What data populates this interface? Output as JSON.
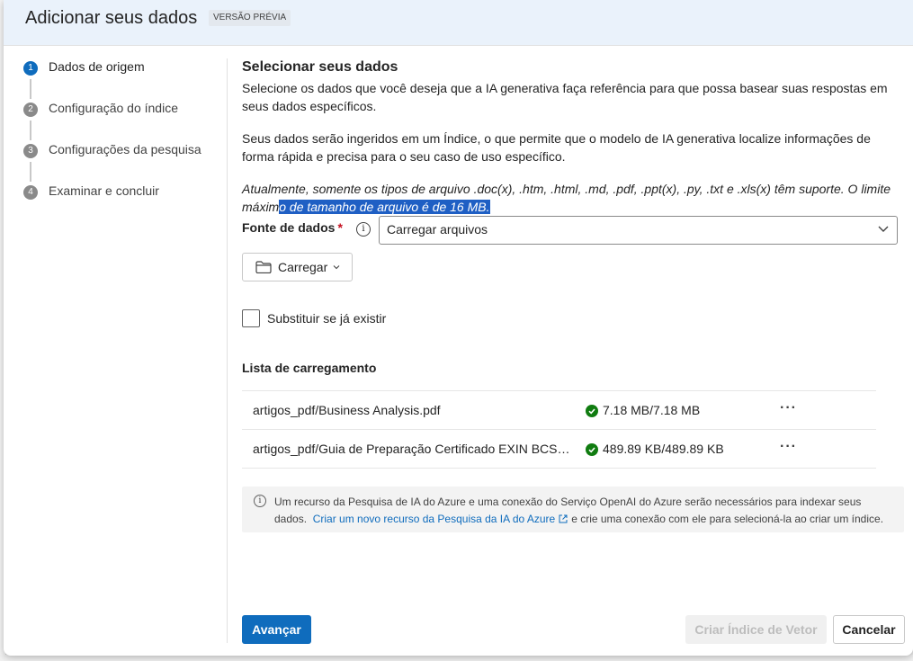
{
  "dialog": {
    "title": "Adicionar seus dados",
    "badge": "VERSÃO PRÉVIA"
  },
  "steps": [
    {
      "num": "1",
      "label": "Dados de origem",
      "active": true
    },
    {
      "num": "2",
      "label": "Configuração do índice",
      "active": false
    },
    {
      "num": "3",
      "label": "Configurações da pesquisa",
      "active": false
    },
    {
      "num": "4",
      "label": "Examinar e concluir",
      "active": false
    }
  ],
  "main": {
    "heading": "Selecionar seus dados",
    "desc1": "Selecione os dados que você deseja que a IA generativa faça referência para que possa basear suas respostas em seus dados específicos.",
    "desc2": "Seus dados serão ingeridos em um Índice, o que permite que o modelo de IA generativa localize informações de forma rápida e precisa para o seu caso de uso específico.",
    "note_plain": "Atualmente, somente os tipos de arquivo .doc(x), .htm, .html, .md, .pdf, .ppt(x), .py, .txt e .xls(x) têm suporte. O limite máxim",
    "note_selected": "o de tamanho de arquivo é de 16 MB.",
    "data_source": {
      "label": "Fonte de dados",
      "required_mark": "*",
      "info_glyph": "i",
      "value": "Carregar arquivos"
    },
    "upload_button": "Carregar",
    "overwrite_label": "Substituir se já existir",
    "overwrite_checked": false,
    "upload_list": {
      "title": "Lista de carregamento",
      "rows": [
        {
          "file": "artigos_pdf/Business Analysis.pdf",
          "size": "7.18 MB/7.18 MB",
          "status": "completed"
        },
        {
          "file": "artigos_pdf/Guia de Preparação Certificado EXIN BCS B...",
          "size": "489.89 KB/489.89 KB",
          "status": "completed"
        }
      ],
      "more_glyph": "···"
    },
    "notice": {
      "info_glyph": "i",
      "text_before": "Um recurso da Pesquisa de IA do Azure e uma conexão do Serviço OpenAI do Azure serão necessários para indexar seus dados.",
      "link": "Criar um novo recurso da Pesquisa da IA do Azure",
      "text_after": "e crie uma conexão com ele para selecioná-la ao criar um índice."
    }
  },
  "footer": {
    "next": "Avançar",
    "create_index": "Criar Índice de Vetor",
    "cancel": "Cancelar"
  },
  "colors": {
    "primary": "#0f6cbd",
    "success": "#107c10",
    "required": "#c50f1f",
    "header_bg": "#eaf2fb",
    "selection": "#1f5fc4"
  },
  "icons": [
    "folder-icon",
    "chevron-down-icon",
    "info-icon",
    "checkmark-circle-icon",
    "more-options-icon",
    "external-link-icon"
  ]
}
